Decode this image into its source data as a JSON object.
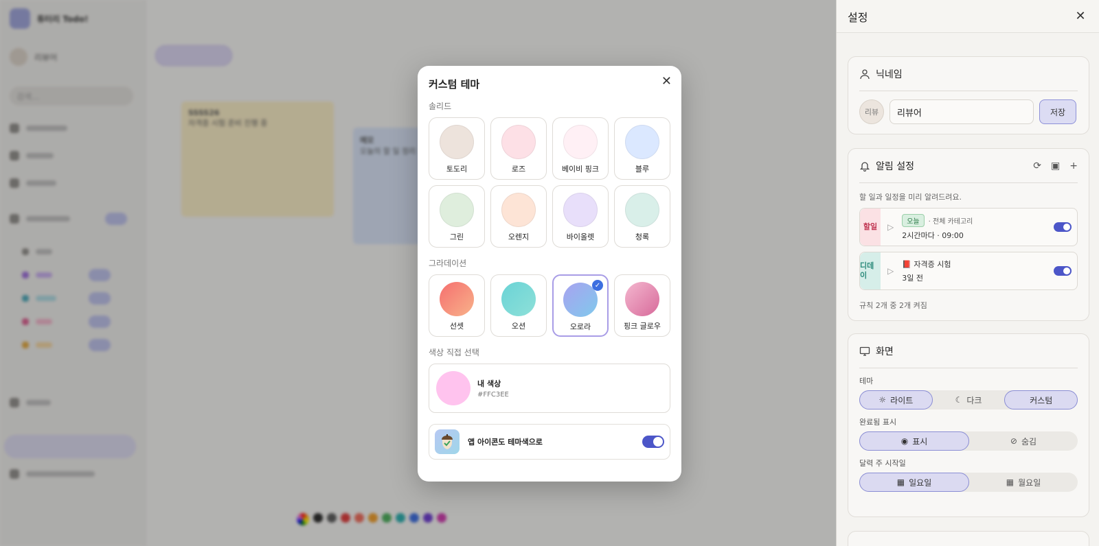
{
  "background": {
    "sidebar_title": "튜터리 Todo!",
    "user_name": "리뷰어",
    "search_placeholder": "검색...",
    "note1_title": "SSSS26",
    "note1_body": "자격증 시험 준비 진행 중",
    "note2_title": "메모",
    "note2_body": "오늘의 할 일 정리"
  },
  "settings": {
    "title": "설정",
    "nickname": {
      "title": "닉네임",
      "avatar": "리뷰",
      "value": "리뷰어",
      "save_label": "저장"
    },
    "alarm": {
      "title": "알림 설정",
      "desc": "할 일과 일정을 미리 알려드려요.",
      "items": [
        {
          "tag": "할일",
          "chip": "오늘",
          "category": "· 전체 카테고리",
          "detail": "2시간마다 · 09:00",
          "enabled": true
        },
        {
          "tag": "디데이",
          "title": "📕 자격증 시험",
          "detail": "3일 전",
          "enabled": true
        }
      ],
      "summary": "규칙 2개 중 2개 켜짐"
    },
    "display": {
      "title": "화면",
      "theme_label": "테마",
      "theme_options": [
        "라이트",
        "다크",
        "커스텀"
      ],
      "completed_label": "완료됨 표시",
      "completed_options": [
        "표시",
        "숨김"
      ],
      "week_label": "달력 주 시작일",
      "week_options": [
        "일요일",
        "월요일"
      ]
    }
  },
  "modal": {
    "title": "커스텀 테마",
    "solid_label": "솔리드",
    "solid": [
      {
        "name": "토도리",
        "color": "#ede3dc"
      },
      {
        "name": "로즈",
        "color": "#fde0e6"
      },
      {
        "name": "베이비 핑크",
        "color": "#fff0f5"
      },
      {
        "name": "블루",
        "color": "#dbe8ff"
      },
      {
        "name": "그린",
        "color": "#dfeedd"
      },
      {
        "name": "오렌지",
        "color": "#fde4d6"
      },
      {
        "name": "바이올렛",
        "color": "#e8dffa"
      },
      {
        "name": "청록",
        "color": "#d9efe9"
      }
    ],
    "gradient_label": "그라데이션",
    "gradient": [
      {
        "name": "선셋",
        "from": "#f56f6f",
        "to": "#f8b28a"
      },
      {
        "name": "오션",
        "from": "#6ad3d6",
        "to": "#8ee0d8"
      },
      {
        "name": "오로라",
        "from": "#a8a2f0",
        "to": "#80c9ec",
        "selected": true
      },
      {
        "name": "핑크 글로우",
        "from": "#f4b7cf",
        "to": "#d76a9a"
      }
    ],
    "custom_label": "색상 직접 선택",
    "custom": {
      "name": "내 색상",
      "hex": "#FFC3EE",
      "color": "#ffc3ee"
    },
    "app_icon_label": "앱 아이콘도 테마색으로",
    "app_icon_enabled": true
  }
}
